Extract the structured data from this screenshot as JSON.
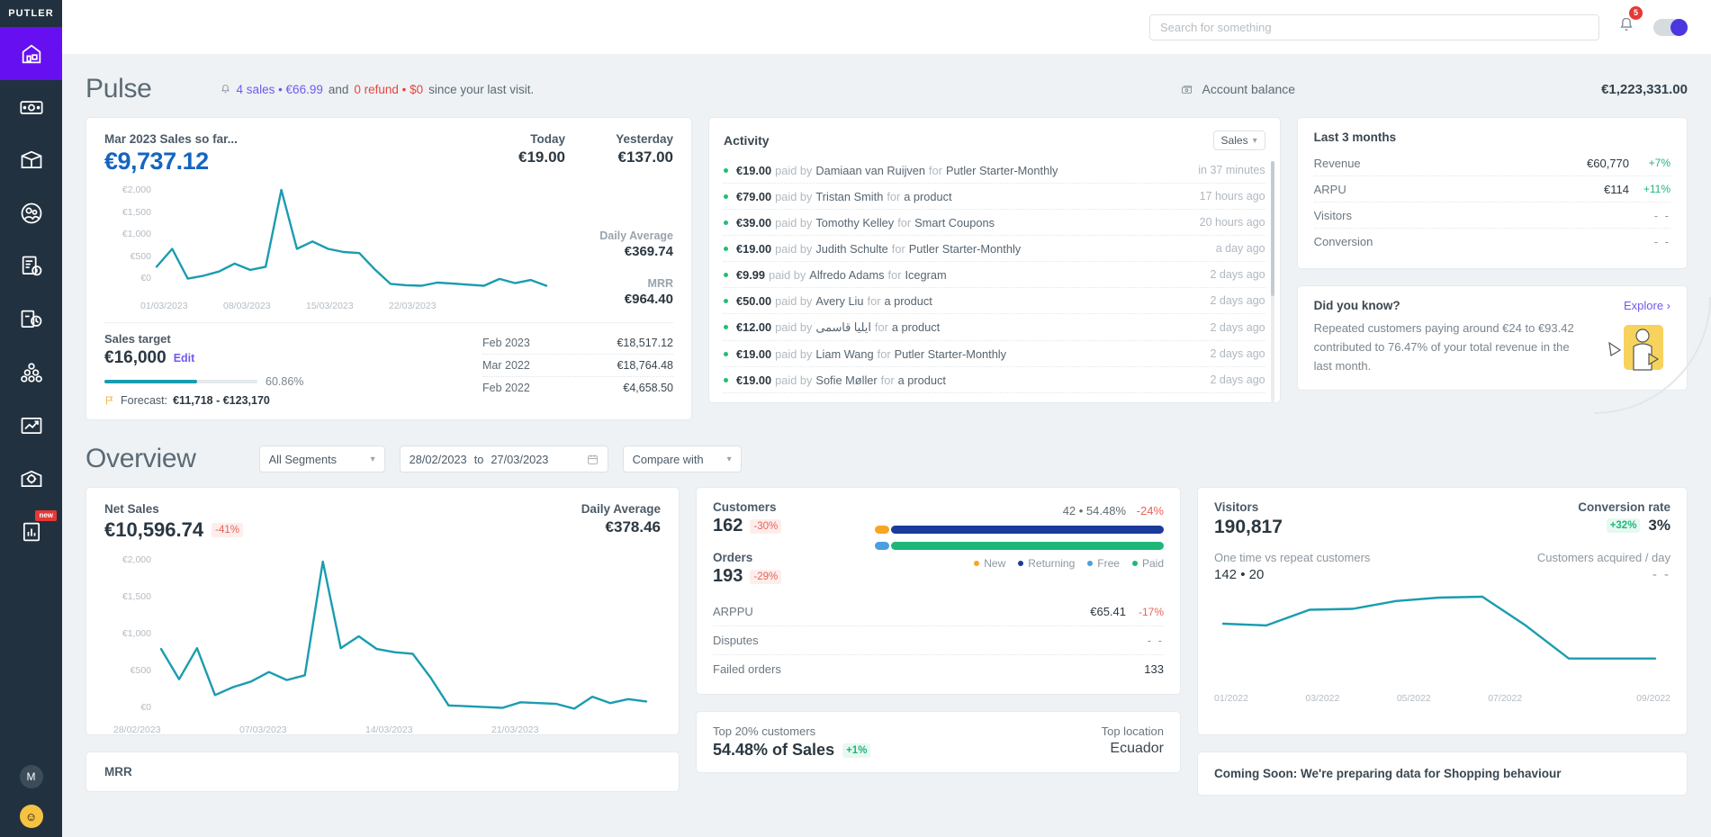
{
  "brand": "PUTLER",
  "sidebar": {
    "items": [
      {
        "name": "home-icon",
        "label": "Home",
        "active": true
      },
      {
        "name": "sales-icon",
        "label": "Sales",
        "active": false
      },
      {
        "name": "products-icon",
        "label": "Products",
        "active": false
      },
      {
        "name": "customers-icon",
        "label": "Customers",
        "active": false
      },
      {
        "name": "transactions-icon",
        "label": "Transactions",
        "active": false
      },
      {
        "name": "subscriptions-icon",
        "label": "Subscriptions",
        "active": false
      },
      {
        "name": "audience-icon",
        "label": "Audience",
        "active": false
      },
      {
        "name": "insights-icon",
        "label": "Insights",
        "active": false
      },
      {
        "name": "settings-icon",
        "label": "Settings",
        "active": false
      },
      {
        "name": "reports-icon",
        "label": "Reports",
        "active": false,
        "badge": "new"
      }
    ],
    "avatar_initial": "M",
    "help_glyph": "☺"
  },
  "topbar": {
    "search_placeholder": "Search for something",
    "search_value": "",
    "notification_count": "5"
  },
  "pulse": {
    "title": "Pulse",
    "note": {
      "sales": "4 sales • €66.99",
      "and": "and",
      "refund": "0 refund • $0",
      "tail": "since your last visit."
    },
    "account_balance_label": "Account balance",
    "account_balance_value": "€1,223,331.00"
  },
  "sales_card": {
    "label": "Mar 2023 Sales so far...",
    "value": "€9,737.12",
    "today_label": "Today",
    "today_value": "€19.00",
    "yesterday_label": "Yesterday",
    "yesterday_value": "€137.00",
    "daily_average_label": "Daily Average",
    "daily_average_value": "€369.74",
    "mrr_label": "MRR",
    "mrr_value": "€964.40",
    "target_label": "Sales target",
    "target_value": "€16,000",
    "edit_label": "Edit",
    "progress_pct": "60.86%",
    "progress_value": 60.86,
    "forecast_prefix": "Forecast:",
    "forecast_range": "€11,718 - €123,170",
    "history": [
      {
        "period": "Feb 2023",
        "value": "€18,517.12"
      },
      {
        "period": "Mar 2022",
        "value": "€18,764.48"
      },
      {
        "period": "Feb 2022",
        "value": "€4,658.50"
      }
    ]
  },
  "activity": {
    "title": "Activity",
    "filter_value": "Sales",
    "items": [
      {
        "amount": "€19.00",
        "by": "Damiaan van Ruijven",
        "product": "Putler Starter-Monthly",
        "time": "in 37 minutes"
      },
      {
        "amount": "€79.00",
        "by": "Tristan Smith",
        "product": "a product",
        "time": "17 hours ago"
      },
      {
        "amount": "€39.00",
        "by": "Tomothy Kelley",
        "product": "Smart Coupons",
        "time": "20 hours ago"
      },
      {
        "amount": "€19.00",
        "by": "Judith Schulte",
        "product": "Putler Starter-Monthly",
        "time": "a day ago"
      },
      {
        "amount": "€9.99",
        "by": "Alfredo Adams",
        "product": "Icegram",
        "time": "2 days ago"
      },
      {
        "amount": "€50.00",
        "by": "Avery Liu",
        "product": "a product",
        "time": "2 days ago"
      },
      {
        "amount": "€12.00",
        "by": "ایلیا قاسمی",
        "product": "a product",
        "time": "2 days ago"
      },
      {
        "amount": "€19.00",
        "by": "Liam Wang",
        "product": "Putler Starter-Monthly",
        "time": "2 days ago"
      },
      {
        "amount": "€19.00",
        "by": "Sofie Møller",
        "product": "a product",
        "time": "2 days ago"
      }
    ],
    "paid_by_text": "paid by",
    "for_text": "for"
  },
  "last3months": {
    "title": "Last 3 months",
    "rows": [
      {
        "label": "Revenue",
        "value": "€60,770",
        "delta": "+7%"
      },
      {
        "label": "ARPU",
        "value": "€114",
        "delta": "+11%"
      },
      {
        "label": "Visitors",
        "value": "- -",
        "delta": ""
      },
      {
        "label": "Conversion",
        "value": "- -",
        "delta": ""
      }
    ]
  },
  "did_you_know": {
    "title": "Did you know?",
    "explore_label": "Explore ›",
    "body": "Repeated customers paying around €24 to €93.42 contributed to 76.47% of your total revenue in the last month."
  },
  "overview": {
    "title": "Overview",
    "segment_value": "All Segments",
    "date_from": "28/02/2023",
    "date_to": "27/03/2023",
    "date_sep": "to",
    "compare_value": "Compare with"
  },
  "net_sales": {
    "label": "Net Sales",
    "value": "€10,596.74",
    "delta": "-41%",
    "daily_average_label": "Daily Average",
    "daily_average_value": "€378.46"
  },
  "customers_card": {
    "customers_label": "Customers",
    "customers_value": "162",
    "customers_delta": "-30%",
    "orders_label": "Orders",
    "orders_value": "193",
    "orders_delta": "-29%",
    "summary": "42 • 54.48%",
    "summary_delta": "-24%",
    "legend": [
      {
        "label": "New",
        "color": "#f5a623"
      },
      {
        "label": "Returning",
        "color": "#1a3b9c"
      },
      {
        "label": "Free",
        "color": "#4a9fe0"
      },
      {
        "label": "Paid",
        "color": "#1fb779"
      }
    ],
    "rows": [
      {
        "label": "ARPPU",
        "value": "€65.41",
        "delta": "-17%"
      },
      {
        "label": "Disputes",
        "value": "- -",
        "delta": ""
      },
      {
        "label": "Failed orders",
        "value": "133",
        "delta": ""
      }
    ]
  },
  "top20": {
    "label": "Top 20% customers",
    "value": "54.48% of Sales",
    "delta": "+1%",
    "location_label": "Top location",
    "location_value": "Ecuador"
  },
  "visitors_card": {
    "visitors_label": "Visitors",
    "visitors_value": "190,817",
    "conversion_label": "Conversion rate",
    "conversion_value": "3%",
    "conversion_delta": "+32%",
    "repeat_label": "One time vs repeat customers",
    "repeat_value": "142 • 20",
    "acquired_label": "Customers acquired / day",
    "acquired_value": "- -"
  },
  "coming_soon": {
    "text": "Coming Soon: We're preparing data for Shopping behaviour"
  },
  "mrr_card": {
    "label": "MRR"
  },
  "chart_data": [
    {
      "id": "pulse-sales-chart",
      "type": "line",
      "title": "Mar 2023 Sales so far...",
      "ylabel": "",
      "xlabel": "",
      "ylim": [
        0,
        2000
      ],
      "ytick_labels": [
        "€2,000",
        "€1,500",
        "€1,000",
        "€500",
        "€0"
      ],
      "xtick_labels": [
        "01/03/2023",
        "08/03/2023",
        "15/03/2023",
        "22/03/2023"
      ],
      "grid": false,
      "line_color": "#1a9cb0",
      "values": [
        420,
        760,
        195,
        250,
        330,
        480,
        360,
        420,
        1880,
        760,
        900,
        760,
        700,
        680,
        370,
        95,
        70,
        60,
        120,
        100,
        80,
        60,
        190,
        110,
        170,
        60
      ]
    },
    {
      "id": "net-sales-chart",
      "type": "line",
      "title": "Net Sales",
      "ylim": [
        0,
        2000
      ],
      "ytick_labels": [
        "€2,000",
        "€1,500",
        "€1,000",
        "€500",
        "€0"
      ],
      "xtick_labels": [
        "28/02/2023",
        "07/03/2023",
        "14/03/2023",
        "21/03/2023"
      ],
      "grid": false,
      "line_color": "#1a9cb0",
      "values": [
        780,
        400,
        790,
        200,
        300,
        370,
        490,
        390,
        450,
        1880,
        790,
        940,
        780,
        740,
        720,
        420,
        70,
        60,
        50,
        40,
        110,
        100,
        90,
        30,
        180,
        100,
        150,
        120
      ]
    },
    {
      "id": "visitors-chart",
      "type": "line",
      "title": "Visitors",
      "xtick_labels": [
        "01/2022",
        "03/2022",
        "05/2022",
        "07/2022",
        "09/2022"
      ],
      "grid": false,
      "line_color": "#1a9cb0",
      "values": [
        62,
        60,
        78,
        79,
        88,
        92,
        93,
        60,
        22,
        22,
        22
      ]
    }
  ]
}
